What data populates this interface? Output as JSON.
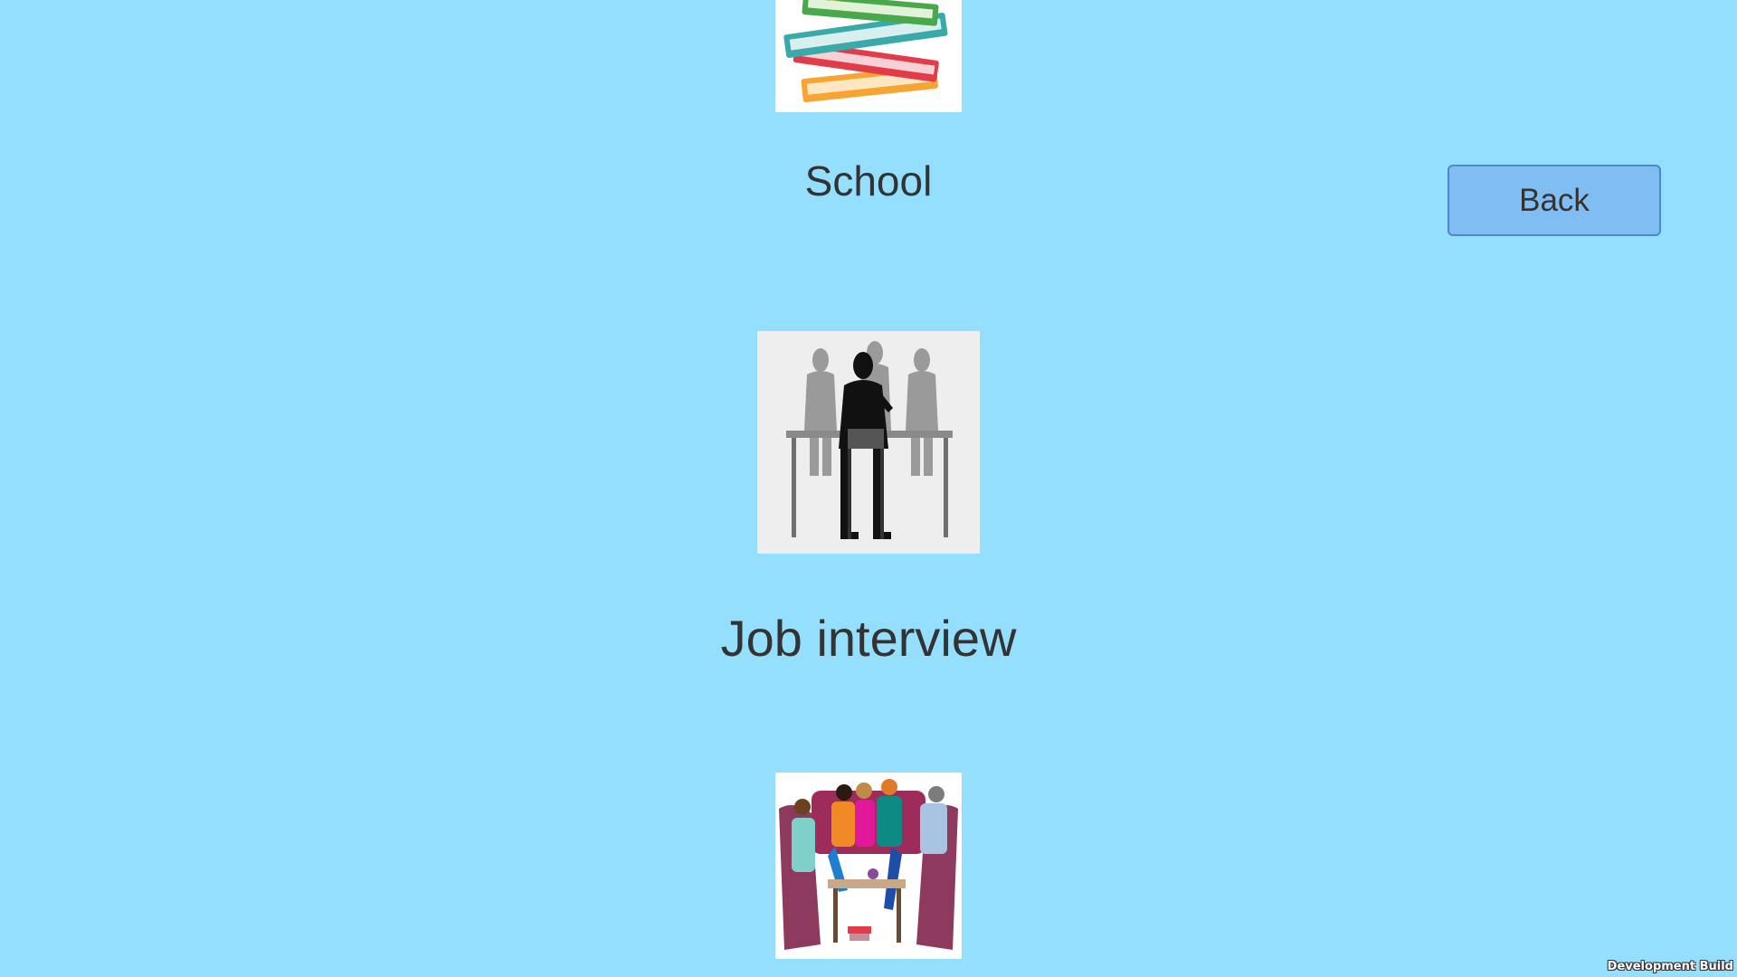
{
  "colors": {
    "background": "#94dffd",
    "button_fill": "#7fbdf3",
    "button_border": "#4a8ac8",
    "text": "#333333"
  },
  "scenarios": [
    {
      "label": "School",
      "icon": "books-stack-icon"
    },
    {
      "label": "Job interview",
      "icon": "job-interview-silhouette-icon"
    },
    {
      "label": "",
      "icon": "group-conversation-icon"
    }
  ],
  "back_button": {
    "label": "Back"
  },
  "footer": {
    "build_label": "Development Build"
  }
}
